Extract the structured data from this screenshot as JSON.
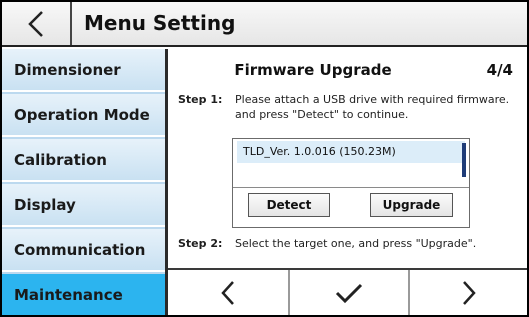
{
  "header": {
    "title": "Menu Setting",
    "back_icon": "chevron-left-icon"
  },
  "sidebar": {
    "items": [
      {
        "label": "Dimensioner",
        "active": false
      },
      {
        "label": "Operation Mode",
        "active": false
      },
      {
        "label": "Calibration",
        "active": false
      },
      {
        "label": "Display",
        "active": false
      },
      {
        "label": "Communication",
        "active": false
      },
      {
        "label": "Maintenance",
        "active": true
      }
    ]
  },
  "panel": {
    "title": "Firmware Upgrade",
    "page": "4/4",
    "step1": {
      "label": "Step 1:",
      "line1": "Please attach a USB drive with required firmware.",
      "line2": "and press \"Detect\" to continue."
    },
    "file_list": [
      "TLD_Ver. 1.0.016 (150.23M)"
    ],
    "detect_label": "Detect",
    "upgrade_label": "Upgrade",
    "step2": {
      "label": "Step 2:",
      "text": "Select the target one, and press \"Upgrade\"."
    }
  },
  "bottom_nav": {
    "icons": [
      "chevron-left-icon",
      "checkmark-icon",
      "chevron-right-icon"
    ]
  },
  "colors": {
    "active_item": "#2cb4ef",
    "sidebar_bg": "#c9e1f2",
    "selection": "#dcedf9",
    "scroll_thumb": "#1e3c78"
  }
}
